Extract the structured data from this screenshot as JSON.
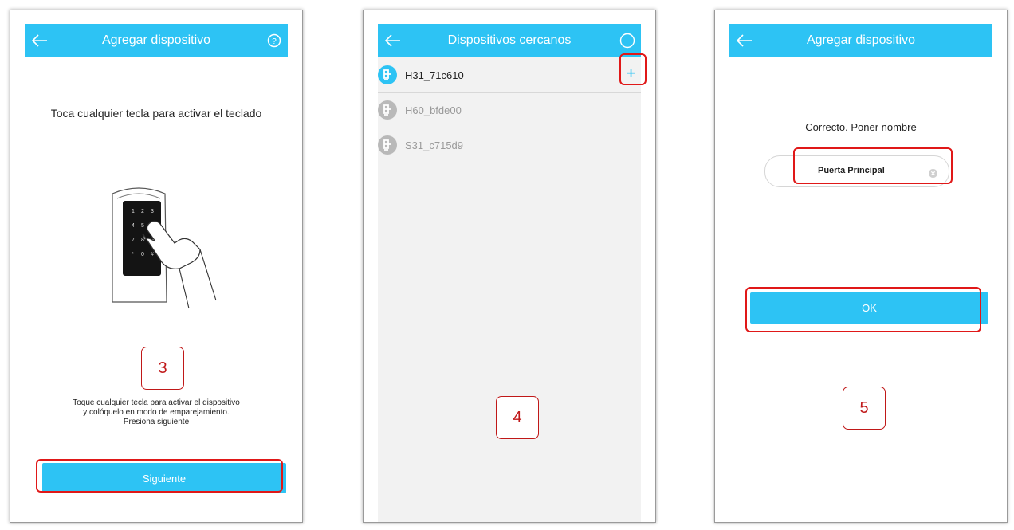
{
  "screens": [
    {
      "title": "Agregar dispositivo",
      "top_text": "Toca cualquier tecla para activar el teclado",
      "keypad_keys": [
        "1",
        "2",
        "3",
        "4",
        "5",
        "6",
        "7",
        "8",
        "9",
        "*",
        "0",
        "#"
      ],
      "bottom_text_lines": [
        "Toque cualquier tecla para activar el dispositivo",
        "y colóquelo en modo de emparejamiento.",
        "Presiona siguiente"
      ],
      "button_label": "Siguiente",
      "step": "3"
    },
    {
      "title": "Dispositivos cercanos",
      "devices": [
        {
          "name": "H31_71c610",
          "active": true
        },
        {
          "name": "H60_bfde00",
          "active": false
        },
        {
          "name": "S31_c715d9",
          "active": false
        }
      ],
      "add_symbol": "+",
      "step": "4"
    },
    {
      "title": "Agregar dispositivo",
      "prompt": "Correcto. Poner nombre",
      "name_value": "Puerta Principal",
      "button_label": "OK",
      "step": "5"
    }
  ],
  "colors": {
    "accent": "#2dc3f4",
    "highlight": "#e01818"
  }
}
